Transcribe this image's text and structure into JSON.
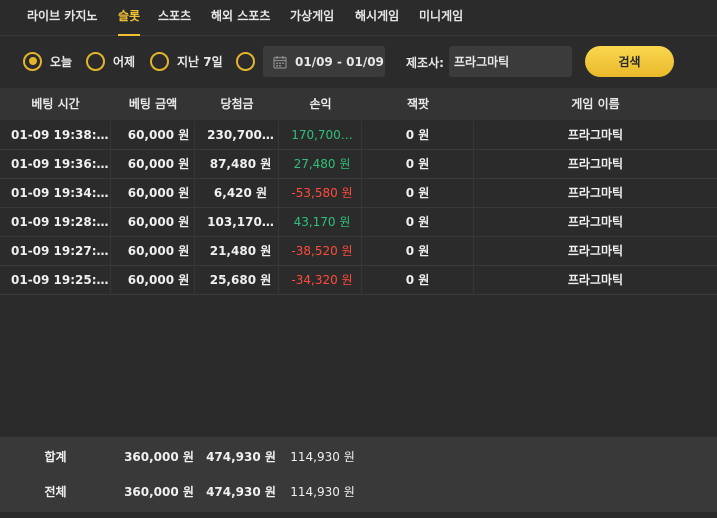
{
  "tabs": [
    {
      "label": "라이브 카지노",
      "active": false
    },
    {
      "label": "슬롯",
      "active": true
    },
    {
      "label": "스포츠",
      "active": false
    },
    {
      "label": "해외 스포츠",
      "active": false
    },
    {
      "label": "가상게임",
      "active": false
    },
    {
      "label": "해시게임",
      "active": false
    },
    {
      "label": "미니게임",
      "active": false
    }
  ],
  "filter": {
    "radios": [
      {
        "label": "오늘",
        "selected": true
      },
      {
        "label": "어제",
        "selected": false
      },
      {
        "label": "지난 7일",
        "selected": false
      },
      {
        "label": "",
        "selected": false
      }
    ],
    "date_range": "01/09 - 01/09",
    "maker_label": "제조사:",
    "maker_value": "프라그마틱",
    "search_label": "검색"
  },
  "table": {
    "headers": [
      "베팅 시간",
      "베팅 금액",
      "당첨금",
      "손익",
      "잭팟",
      "게임 이름"
    ],
    "rows": [
      {
        "time": "01-09 19:38:…",
        "bet": "60,000 원",
        "win": "230,700…",
        "pl": "170,700…",
        "pl_sign": "pos",
        "jackpot": "0 원",
        "game": "프라그마틱"
      },
      {
        "time": "01-09 19:36:…",
        "bet": "60,000 원",
        "win": "87,480 원",
        "pl": "27,480 원",
        "pl_sign": "pos",
        "jackpot": "0 원",
        "game": "프라그마틱"
      },
      {
        "time": "01-09 19:34:…",
        "bet": "60,000 원",
        "win": "6,420 원",
        "pl": "-53,580 원",
        "pl_sign": "neg",
        "jackpot": "0 원",
        "game": "프라그마틱"
      },
      {
        "time": "01-09 19:28:…",
        "bet": "60,000 원",
        "win": "103,170…",
        "pl": "43,170 원",
        "pl_sign": "pos",
        "jackpot": "0 원",
        "game": "프라그마틱"
      },
      {
        "time": "01-09 19:27:…",
        "bet": "60,000 원",
        "win": "21,480 원",
        "pl": "-38,520 원",
        "pl_sign": "neg",
        "jackpot": "0 원",
        "game": "프라그마틱"
      },
      {
        "time": "01-09 19:25:…",
        "bet": "60,000 원",
        "win": "25,680 원",
        "pl": "-34,320 원",
        "pl_sign": "neg",
        "jackpot": "0 원",
        "game": "프라그마틱"
      }
    ]
  },
  "summary": {
    "subtotal": {
      "label": "합계",
      "bet": "360,000 원",
      "win": "474,930 원",
      "pl": "114,930 원"
    },
    "total": {
      "label": "전체",
      "bet": "360,000 원",
      "win": "474,930 원",
      "pl": "114,930 원"
    }
  },
  "colors": {
    "accent": "#f3c233",
    "positive": "#2ec07a",
    "negative": "#ff4a3c",
    "background": "#2b2b2b"
  }
}
